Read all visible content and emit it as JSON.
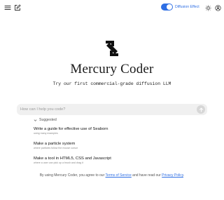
{
  "header": {
    "diffusion_toggle": {
      "label": "Diffusion Effect",
      "on": true
    },
    "icons": [
      "menu-icon",
      "compose-icon",
      "sun-icon",
      "user-icon"
    ]
  },
  "brand": {
    "name": "Mercury Coder",
    "tagline": "Try our first commercial-grade diffusion LLM"
  },
  "prompt": {
    "placeholder": "How can I help you code?",
    "value": ""
  },
  "suggestions": {
    "heading": "Suggested",
    "items": [
      {
        "title": "Write a guide for effective use of Seaborn",
        "desc": "using many examples"
      },
      {
        "title": "Make a particle system",
        "desc": "where particles follow the mouse cursor"
      },
      {
        "title": "Make a tool in HTML5, CSS and Javascript",
        "desc": "where a user can pick up a brush and drag it"
      }
    ]
  },
  "footer": {
    "prefix": "By using Mercury Coder, you agree to our ",
    "tos": "Terms of Service",
    "middle": " and have read our ",
    "privacy": "Privacy Policy",
    "suffix": "."
  },
  "colors": {
    "accent": "#2f6fe4",
    "input_bg": "#f0f0f0"
  }
}
